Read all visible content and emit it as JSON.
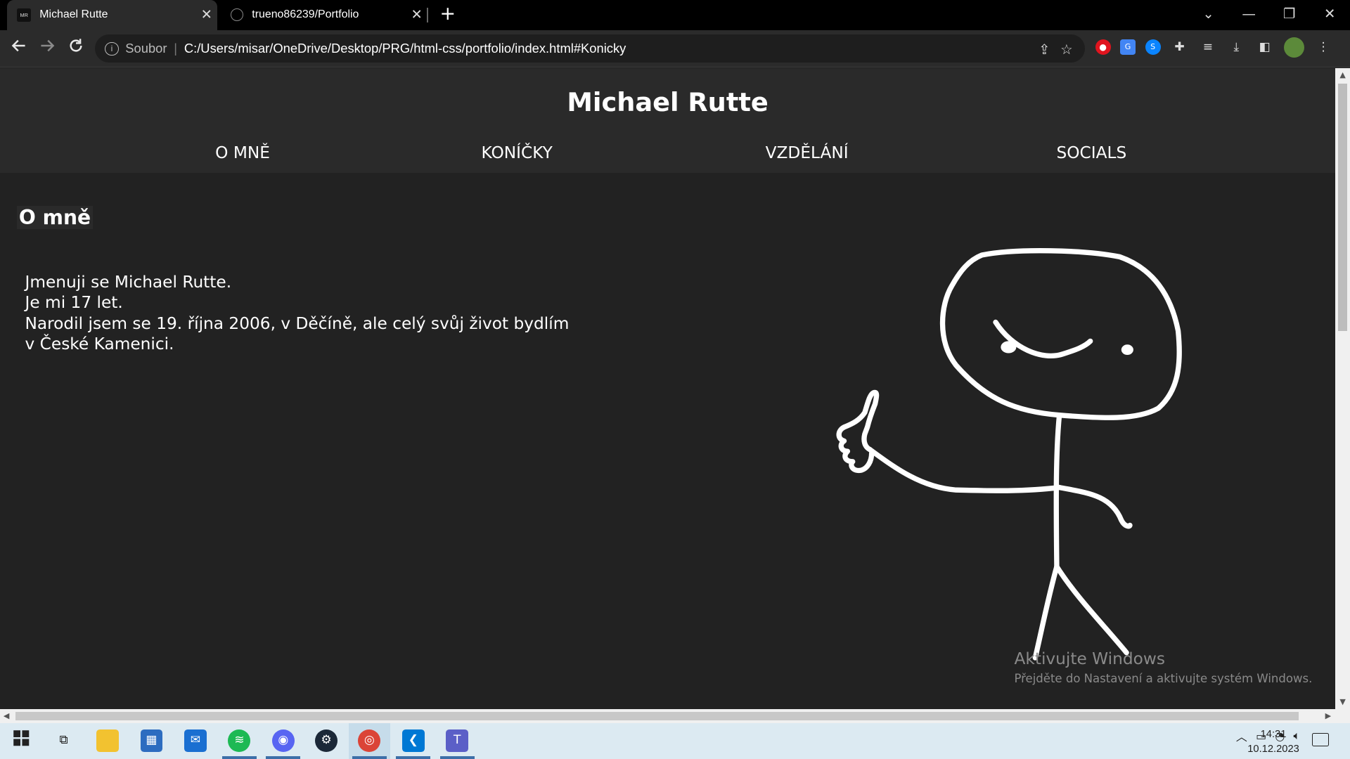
{
  "browser": {
    "tabs": [
      {
        "title": "Michael Rutte",
        "favicon": "MR",
        "active": true
      },
      {
        "title": "trueno86239/Portfolio",
        "favicon": "github-icon",
        "active": false
      }
    ],
    "new_tab": "+",
    "window_controls": {
      "tab_search": "⌄",
      "minimize": "—",
      "restore": "❐",
      "close": "✕"
    },
    "address": {
      "scheme_label": "Soubor",
      "separator": "|",
      "url": "C:/Users/misar/OneDrive/Desktop/PRG/html-css/portfolio/index.html#Konicky"
    }
  },
  "site": {
    "title": "Michael Rutte",
    "nav": [
      "O MNĚ",
      "KONÍČKY",
      "VZDĚLÁNÍ",
      "SOCIALS"
    ],
    "section_heading": "O mně",
    "about_lines": [
      "Jmenuji se Michael Rutte.",
      "Je mi 17 let.",
      "Narodil jsem se 19. října 2006, v Děčíně, ale celý svůj život bydlím",
      "v České Kamenici."
    ],
    "image": "stick-figure-thumbs-up"
  },
  "watermark": {
    "line1": "Aktivujte Windows",
    "line2": "Přejděte do Nastavení a aktivujte systém Windows."
  },
  "taskbar": {
    "apps": [
      "start-icon",
      "task-view-icon",
      "file-explorer-icon",
      "store-icon",
      "mail-icon",
      "spotify-icon",
      "discord-icon",
      "steam-icon",
      "chrome-icon",
      "vscode-icon",
      "teams-icon"
    ],
    "time": "14:31",
    "date": "10.12.2023"
  }
}
